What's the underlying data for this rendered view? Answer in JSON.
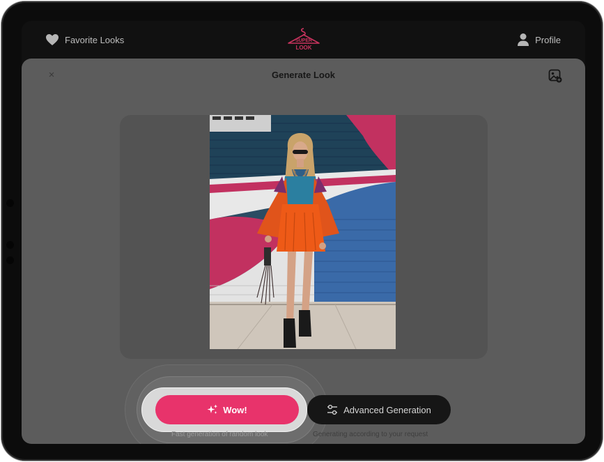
{
  "header": {
    "favorites_label": "Favorite Looks",
    "logo_text_top": "SUPER",
    "logo_text_bottom": "LOOK",
    "profile_label": "Profile"
  },
  "sheet": {
    "title": "Generate Look",
    "close_glyph": "×"
  },
  "actions": {
    "wow_label": "Wow!",
    "wow_caption": "Fast generation of random look",
    "advanced_label": "Advanced Generation",
    "advanced_caption": "Generating according to your request"
  },
  "icons": {
    "favorites": "heart-icon",
    "profile": "person-icon",
    "close": "close-icon",
    "gallery": "image-add-icon",
    "wow": "sparkle-icon",
    "advanced": "sliders-icon"
  },
  "colors": {
    "accent": "#e8336b",
    "dark_button": "#161616",
    "logo": "#e8336b"
  }
}
